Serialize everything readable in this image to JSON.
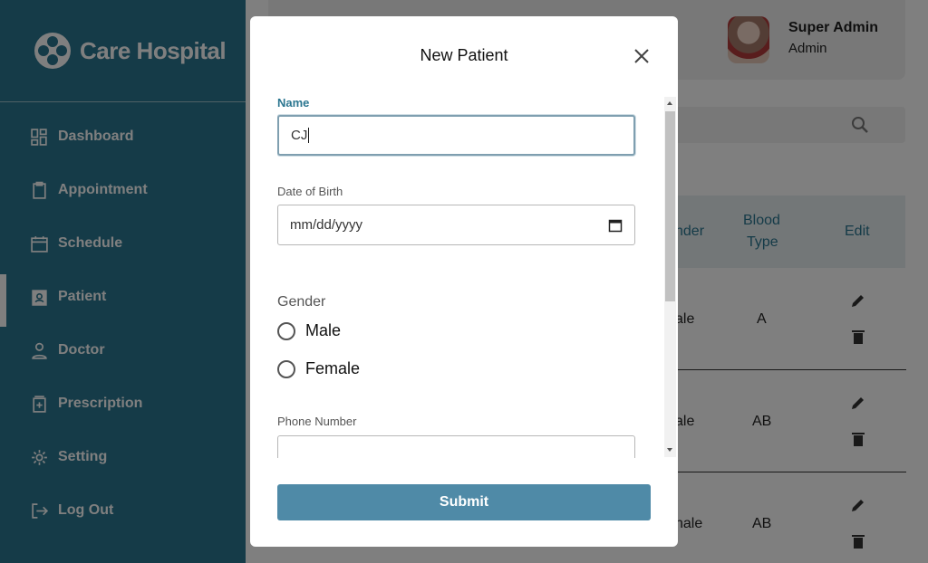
{
  "app": {
    "title": "Care Hospital"
  },
  "sidebar": {
    "items": [
      {
        "label": "Dashboard",
        "icon": "dashboard-icon"
      },
      {
        "label": "Appointment",
        "icon": "clipboard-icon"
      },
      {
        "label": "Schedule",
        "icon": "calendar-icon"
      },
      {
        "label": "Patient",
        "icon": "patient-badge-icon",
        "active": true
      },
      {
        "label": "Doctor",
        "icon": "user-icon"
      },
      {
        "label": "Prescription",
        "icon": "prescription-icon"
      },
      {
        "label": "Setting",
        "icon": "gear-icon"
      },
      {
        "label": "Log Out",
        "icon": "logout-icon"
      }
    ]
  },
  "header": {
    "user_name": "Super Admin",
    "user_role": "Admin"
  },
  "table": {
    "headers": {
      "gender_partial": "nder",
      "blood_type_line1": "Blood",
      "blood_type_line2": "Type",
      "edit": "Edit"
    },
    "rows": [
      {
        "gender_partial": "ale",
        "blood_type": "A"
      },
      {
        "gender_partial": "ale",
        "blood_type": "AB"
      },
      {
        "gender_partial": "nale",
        "blood_type": "AB"
      }
    ]
  },
  "modal": {
    "title": "New Patient",
    "name_label": "Name",
    "name_value": "CJ",
    "dob_label": "Date of Birth",
    "dob_placeholder": "mm/dd/yyyy",
    "gender_label": "Gender",
    "gender_options": [
      "Male",
      "Female"
    ],
    "phone_label": "Phone Number",
    "phone_value": "",
    "submit_label": "Submit"
  },
  "colors": {
    "sidebar": "#2b7690",
    "submit": "#4f8aa7",
    "accent_label": "#2b7690"
  }
}
